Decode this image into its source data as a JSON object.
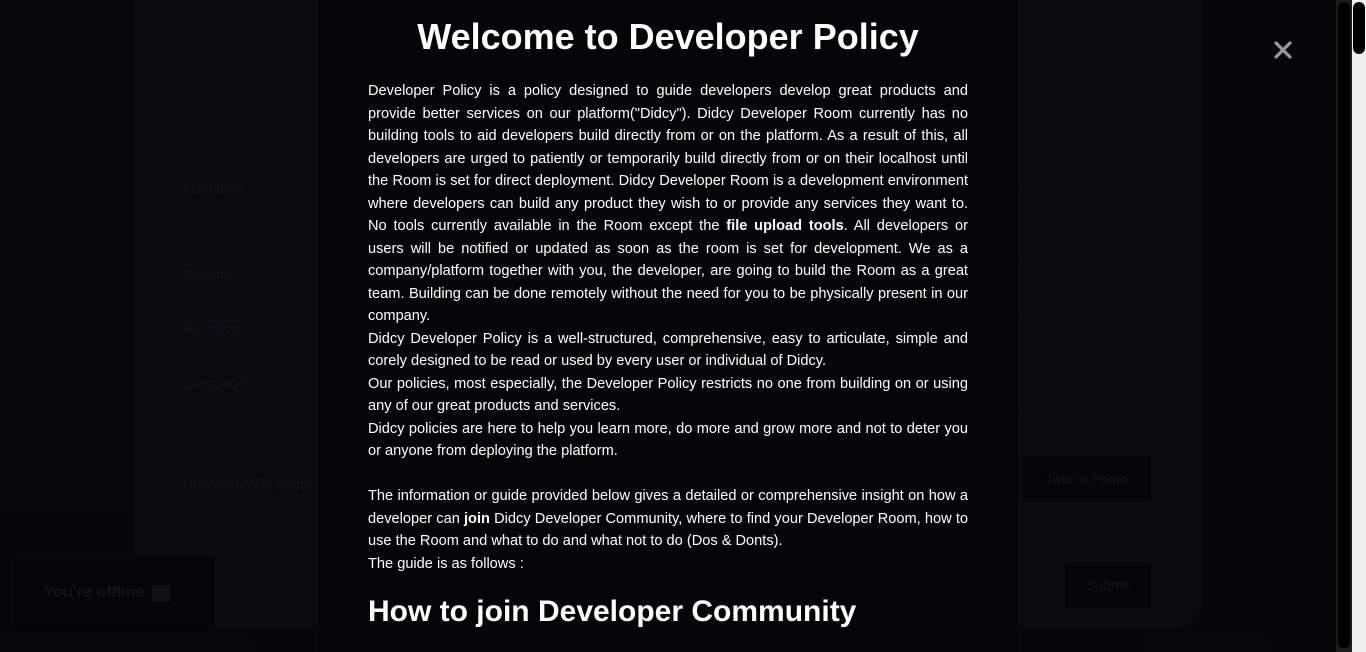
{
  "background_form": {
    "labels": [
      "Institution",
      "Country",
      "Password",
      "Language",
      "Choose profile photo"
    ],
    "take_photo_button": "Take a Photo",
    "submit_button": "Submit",
    "offline_toast": "You're offline"
  },
  "modal": {
    "title": "Welcome to Developer Policy",
    "paragraphs": {
      "p1_a": "Developer Policy is a policy designed to guide developers develop great products and provide better services on our platform(\"Didcy\"). Didcy Developer Room currently has no building tools to aid developers build directly from or on the platform. As a result of this, all developers are urged to patiently or temporarily build directly from or on their localhost until the Room is set for direct deployment. Didcy Developer Room is a development environment where developers can build any product they wish to or provide any services they want to. No tools currently available in the Room except the ",
      "p1_bold": "file upload tools",
      "p1_b": ". All developers or users will be notified or updated as soon as the room is set for development. We as a company/platform together with you, the developer, are going to build the Room as a great team. Building can be done remotely without the need for you to be physically present in our company.",
      "p2": "Didcy Developer Policy is a well-structured, comprehensive, easy to articulate, simple and corely designed to be read or used by every user or individual of Didcy.",
      "p3": "Our policies, most especially, the Developer Policy restricts no one from building on or using any of our great products and services.",
      "p4": "Didcy policies are here to help you learn more, do more and grow more and not to deter you or anyone from deploying the platform.",
      "p5_a": "The information or guide provided below gives a detailed or comprehensive insight on how a developer can ",
      "p5_bold": "join",
      "p5_b": " Didcy Developer Community, where to find your Developer Room, how to use the Room and what to do and what not to do (Dos & Donts).",
      "p6": "The guide is as follows :"
    },
    "section_heading": "How to join Developer Community",
    "close_icon": "close-icon"
  }
}
